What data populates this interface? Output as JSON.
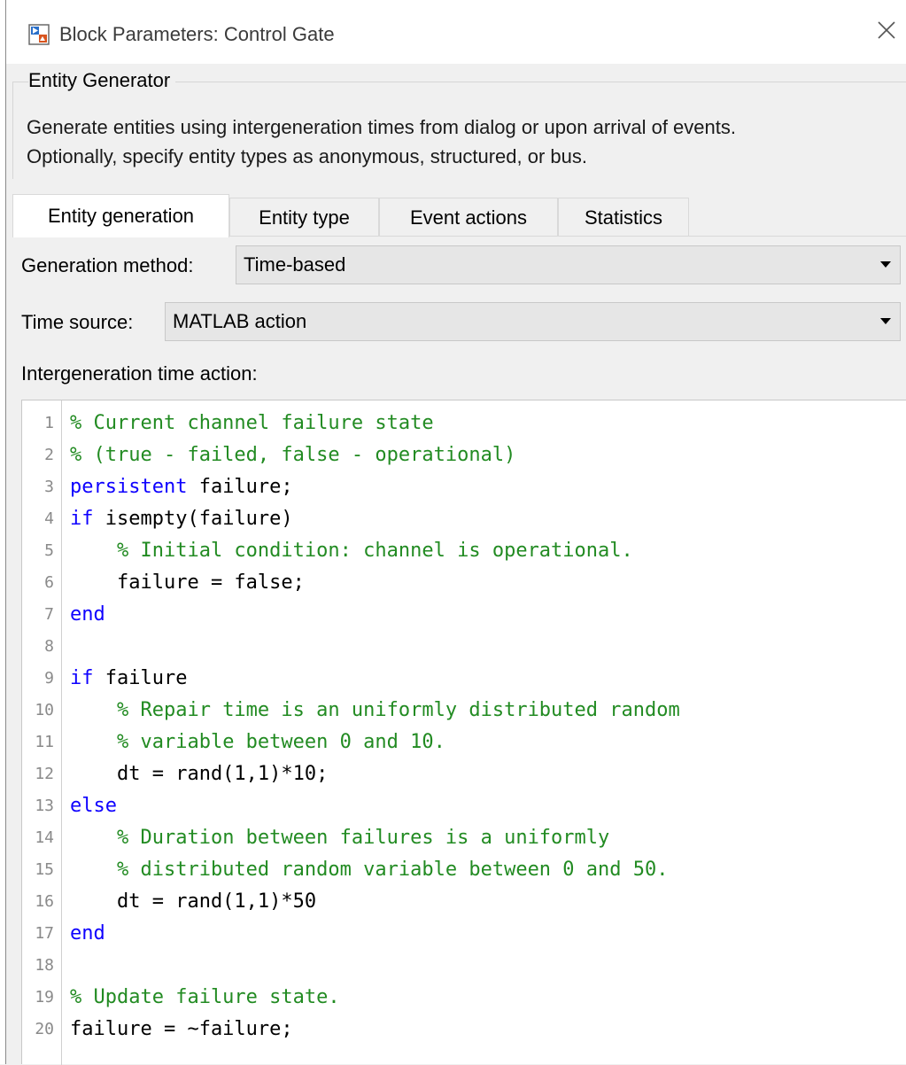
{
  "window": {
    "title": "Block Parameters: Control Gate",
    "close_icon": "close-icon"
  },
  "group": {
    "legend": "Entity Generator",
    "description_line1": "Generate entities using intergeneration times from dialog or upon arrival of events.",
    "description_line2": "Optionally, specify entity types as anonymous, structured, or bus."
  },
  "tabs": [
    {
      "label": "Entity generation",
      "active": true
    },
    {
      "label": "Entity type",
      "active": false
    },
    {
      "label": "Event actions",
      "active": false
    },
    {
      "label": "Statistics",
      "active": false
    }
  ],
  "form": {
    "generation_method_label": "Generation method:",
    "generation_method_value": "Time-based",
    "time_source_label": "Time source:",
    "time_source_value": "MATLAB action",
    "action_label": "Intergeneration time action:"
  },
  "code": {
    "lines": [
      {
        "n": "1",
        "segments": [
          {
            "t": "% Current channel failure state",
            "c": "cm"
          }
        ]
      },
      {
        "n": "2",
        "segments": [
          {
            "t": "% (true - failed, false - operational)",
            "c": "cm"
          }
        ]
      },
      {
        "n": "3",
        "segments": [
          {
            "t": "persistent",
            "c": "kw"
          },
          {
            "t": " failure;",
            "c": "tx"
          }
        ]
      },
      {
        "n": "4",
        "segments": [
          {
            "t": "if",
            "c": "kw"
          },
          {
            "t": " isempty(failure)",
            "c": "tx"
          }
        ]
      },
      {
        "n": "5",
        "segments": [
          {
            "t": "    ",
            "c": "tx"
          },
          {
            "t": "% Initial condition: channel is operational.",
            "c": "cm"
          }
        ]
      },
      {
        "n": "6",
        "segments": [
          {
            "t": "    failure = false;",
            "c": "tx"
          }
        ]
      },
      {
        "n": "7",
        "segments": [
          {
            "t": "end",
            "c": "kw"
          }
        ]
      },
      {
        "n": "8",
        "segments": []
      },
      {
        "n": "9",
        "segments": [
          {
            "t": "if",
            "c": "kw"
          },
          {
            "t": " failure",
            "c": "tx"
          }
        ]
      },
      {
        "n": "10",
        "segments": [
          {
            "t": "    ",
            "c": "tx"
          },
          {
            "t": "% Repair time is an uniformly distributed random",
            "c": "cm"
          }
        ]
      },
      {
        "n": "11",
        "segments": [
          {
            "t": "    ",
            "c": "tx"
          },
          {
            "t": "% variable between 0 and 10.",
            "c": "cm"
          }
        ]
      },
      {
        "n": "12",
        "segments": [
          {
            "t": "    dt = rand(1,1)*10;",
            "c": "tx"
          }
        ]
      },
      {
        "n": "13",
        "segments": [
          {
            "t": "else",
            "c": "kw"
          }
        ]
      },
      {
        "n": "14",
        "segments": [
          {
            "t": "    ",
            "c": "tx"
          },
          {
            "t": "% Duration between failures is a uniformly",
            "c": "cm"
          }
        ]
      },
      {
        "n": "15",
        "segments": [
          {
            "t": "    ",
            "c": "tx"
          },
          {
            "t": "% distributed random variable between 0 and 50.",
            "c": "cm"
          }
        ]
      },
      {
        "n": "16",
        "segments": [
          {
            "t": "    dt = rand(1,1)*50",
            "c": "tx"
          }
        ]
      },
      {
        "n": "17",
        "segments": [
          {
            "t": "end",
            "c": "kw"
          }
        ]
      },
      {
        "n": "18",
        "segments": []
      },
      {
        "n": "19",
        "segments": [
          {
            "t": "% Update failure state.",
            "c": "cm"
          }
        ]
      },
      {
        "n": "20",
        "segments": [
          {
            "t": "failure = ~failure;",
            "c": "tx"
          }
        ]
      }
    ]
  },
  "colors": {
    "keyword": "#0e00ff",
    "comment": "#228b22",
    "line_number": "#8a8a8a"
  }
}
